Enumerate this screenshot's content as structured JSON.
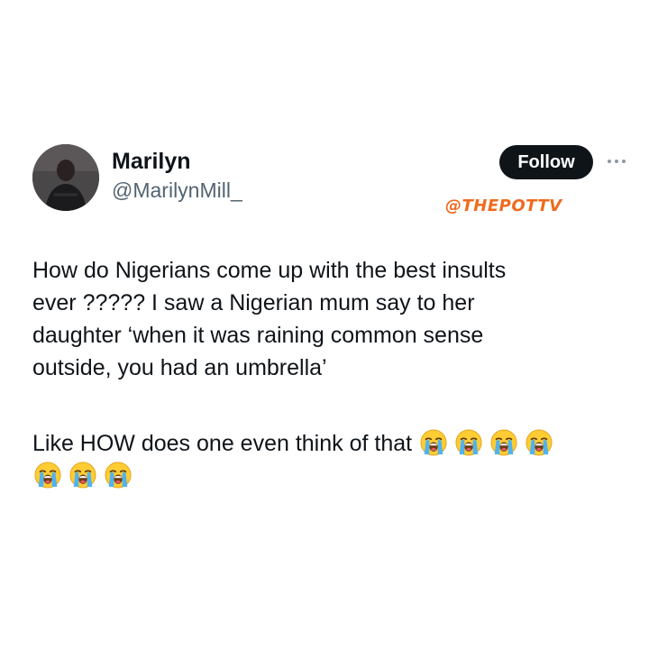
{
  "author": {
    "display_name": "Marilyn",
    "handle": "@MarilynMill_"
  },
  "follow_label": "Follow",
  "watermark": "@THEPOTTV",
  "tweet": {
    "lines": [
      "How do Nigerians come up with the best insults",
      "ever ????? I saw a Nigerian mum say to her",
      "daughter ‘when it was raining common sense",
      "outside, you had an umbrella’"
    ],
    "second_paragraph": "Like HOW does one even think of that",
    "emoji": "loudly-crying-face",
    "emoji_count_line1": 4,
    "emoji_count_line2": 3
  },
  "icons": {
    "more": "more-options-icon",
    "avatar": "profile-photo"
  },
  "colors": {
    "follow_bg": "#0f1419",
    "handle": "#536471",
    "watermark": "#f06a1e"
  }
}
